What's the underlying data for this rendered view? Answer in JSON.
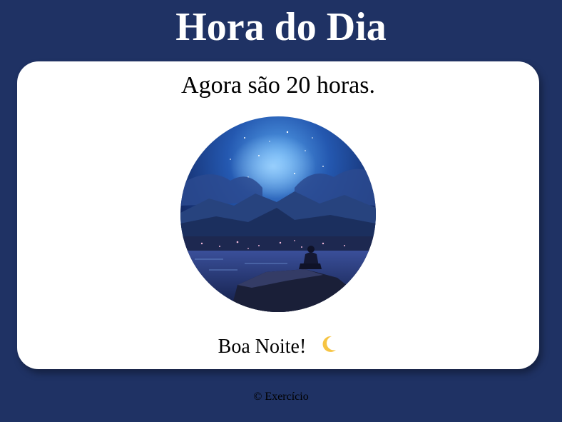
{
  "page": {
    "title": "Hora do Dia",
    "background_color": "#1f3264"
  },
  "card": {
    "time_message": "Agora são 20 horas.",
    "photo": {
      "icon": "night-landscape-photo",
      "description_scene": "night"
    },
    "greeting": "Boa Noite!",
    "greeting_icon": "crescent-moon-icon"
  },
  "footer": {
    "text": "© Exercício"
  }
}
